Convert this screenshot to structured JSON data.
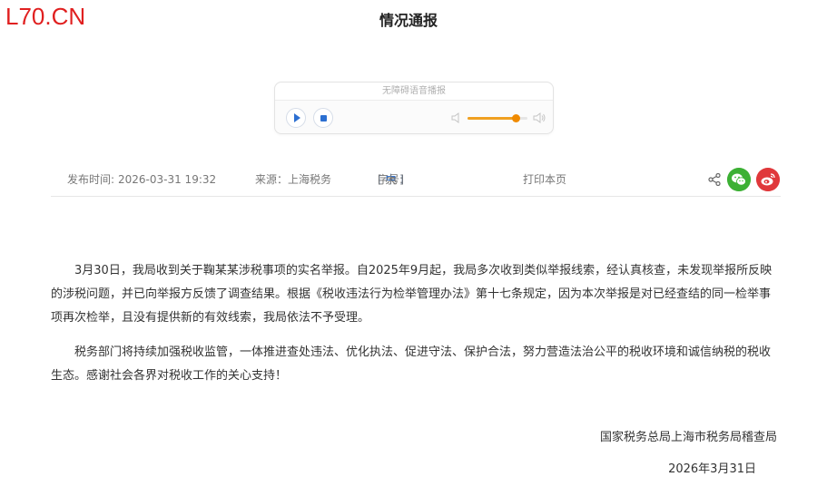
{
  "watermark": "L70.CN",
  "article": {
    "title": "情况通报"
  },
  "player": {
    "label": "无障碍语音播报",
    "volume": 0.8
  },
  "meta": {
    "publish_label": "发布时间:",
    "publish_time": "2026-03-31 19:32",
    "source": "来源：上海税务",
    "fontsize_label": "字号: ",
    "fontsize_large": "[ 大 ]",
    "fontsize_medium": "[ 中 ]",
    "fontsize_small": "[ 小 ]",
    "print": "打印本页"
  },
  "body": {
    "paragraph_1": "3月30日，我局收到关于鞠某某涉税事项的实名举报。自2025年9月起，我局多次收到类似举报线索，经认真核查，未发现举报所反映的涉税问题，并已向举报方反馈了调查结果。根据《税收违法行为检举管理办法》第十七条规定，因为本次举报是对已经查结的同一检举事项再次检举，且没有提供新的有效线索，我局依法不予受理。",
    "paragraph_2": "税务部门将持续加强税收监管，一体推进查处违法、优化执法、促进守法、保护合法，努力营造法治公平的税收环境和诚信纳税的税收生态。感谢社会各界对税收工作的关心支持！"
  },
  "signature": {
    "org": "国家税务总局上海市税务局稽查局",
    "date": "2026年3月31日"
  },
  "colors": {
    "watermark": "#e02020",
    "accent": "#2c6fd1",
    "slider": "#f08a00",
    "wechat": "#3cb034",
    "weibo": "#e0383b"
  }
}
